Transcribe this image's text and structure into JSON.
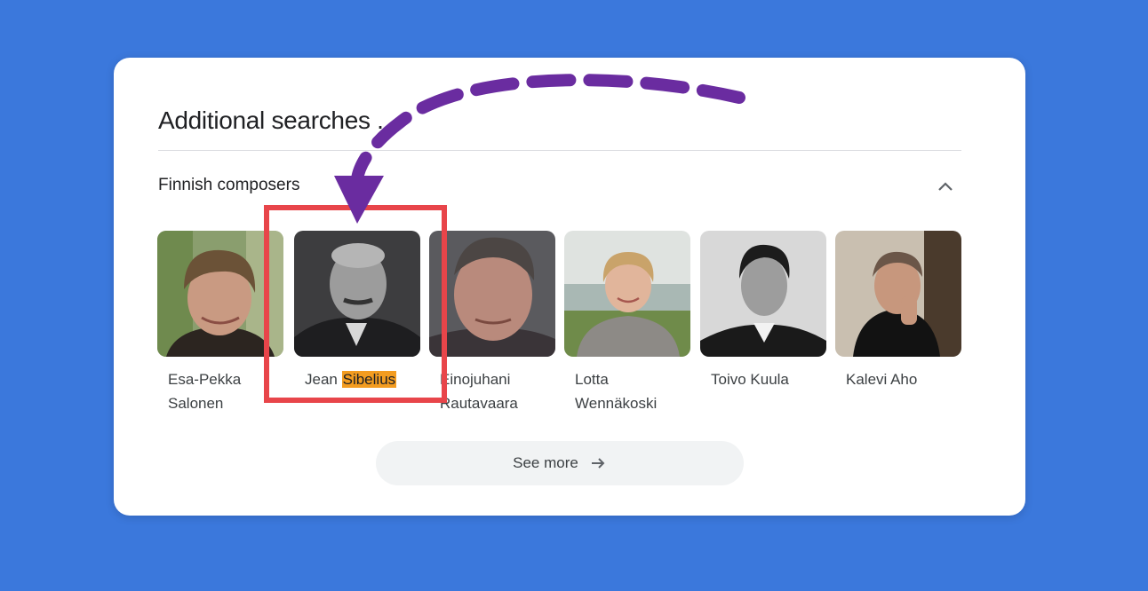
{
  "panel": {
    "title": "Additional searches",
    "title_suffix": "...",
    "section_title": "Finnish composers",
    "collapse_icon": "chevron-up-icon"
  },
  "people": [
    {
      "first": "Esa-Pekka",
      "second": "Salonen"
    },
    {
      "first": "Jean",
      "second": "Sibelius"
    },
    {
      "first": "Einojuhani",
      "second": "Rautavaara"
    },
    {
      "first": "Lotta",
      "second": "Wennäkoski"
    },
    {
      "first": "Toivo Kuula",
      "second": ""
    },
    {
      "first": "Kalevi Aho",
      "second": ""
    }
  ],
  "see_more": {
    "label": "See more",
    "icon": "arrow-right-icon"
  },
  "annotation": {
    "arrow_color": "#6a2ca0",
    "box_color": "#e8454a",
    "highlight_color": "#f39c20"
  }
}
